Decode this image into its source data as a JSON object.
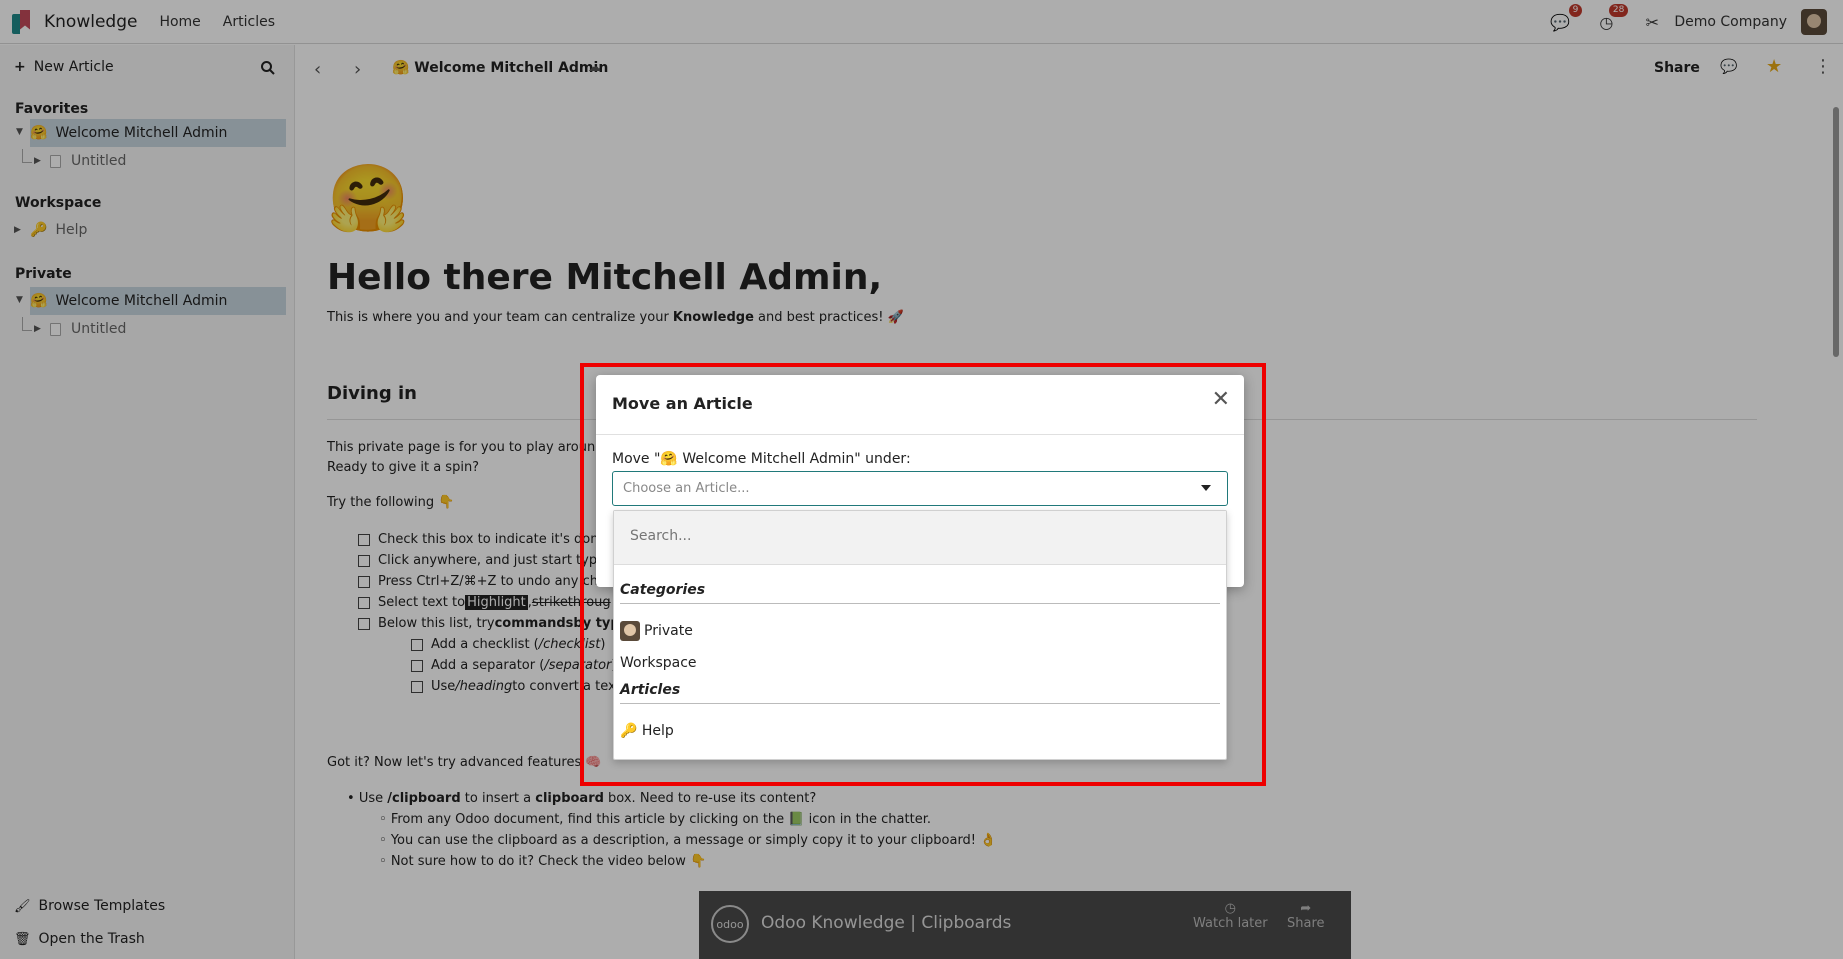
{
  "topbar": {
    "app_name": "Knowledge",
    "menu": [
      "Home",
      "Articles"
    ],
    "messages_count": "9",
    "activities_count": "28",
    "company": "Demo Company"
  },
  "sidebar": {
    "new_article": "New Article",
    "favorites_label": "Favorites",
    "workspace_label": "Workspace",
    "private_label": "Private",
    "favorites": [
      {
        "emoji": "🤗",
        "label": "Welcome Mitchell Admin"
      },
      {
        "label": "Untitled"
      }
    ],
    "workspace": [
      {
        "emoji": "🔑",
        "label": "Help"
      }
    ],
    "private": [
      {
        "emoji": "🤗",
        "label": "Welcome Mitchell Admin"
      },
      {
        "label": "Untitled"
      }
    ],
    "browse_templates": "Browse Templates",
    "open_trash": "Open the Trash"
  },
  "header": {
    "title": "🤗 Welcome Mitchell Admin",
    "share": "Share"
  },
  "article": {
    "emoji": "🤗",
    "heading": "Hello there Mitchell Admin,",
    "intro_pre": "This is where you and your team can centralize your ",
    "intro_bold": "Knowledge",
    "intro_post": " and best practices! 🚀",
    "section_heading": "Diving in",
    "p1": "This private page is for you to play around",
    "p2": "Ready to give it a spin?",
    "p3": "Try the following 👇",
    "checklist": [
      "Check this box to indicate it's done",
      "Click anywhere, and just start typi",
      "Press Ctrl+Z/⌘+Z to undo any chan",
      "Select text to ",
      "Below this list, try "
    ],
    "highlight_word": "Highlight",
    "strike_word": "strikethroug",
    "commands_bold": "commands",
    "by_typ": " by typi",
    "sub_checklist": [
      {
        "pre": "Add a checklist (",
        "italic": "/checklist",
        "post": ")"
      },
      {
        "pre": "Add a separator (",
        "italic": "/separator",
        "post": ")"
      },
      {
        "pre": "Use ",
        "italic": "/heading",
        "post": " to convert a tex"
      }
    ],
    "p4": "Got it? Now let's try advanced features 🧠",
    "bullet1_pre": "Use ",
    "bullet1_cmd": "/clipboard",
    "bullet1_mid": " to insert a ",
    "bullet1_bold": "clipboard",
    "bullet1_post": " box. Need to re-use its content?",
    "sub_bullets": [
      "From any Odoo document, find this article by clicking on the 📗 icon in the chatter.",
      "You can use the clipboard as a description, a message or simply copy it to your clipboard! 👌",
      "Not sure how to do it? Check the video below 👇"
    ],
    "video": {
      "logo": "odoo",
      "title": "Odoo Knowledge | Clipboards",
      "watch_later": "Watch later",
      "share": "Share"
    }
  },
  "modal": {
    "title": "Move an Article",
    "move_label": "Move \"🤗 Welcome Mitchell Admin\" under:",
    "select_placeholder": "Choose an Article..."
  },
  "dropdown": {
    "search_placeholder": "Search...",
    "groups": [
      {
        "label": "Categories",
        "options": [
          "Private",
          "Workspace"
        ]
      },
      {
        "label": "Articles",
        "options": [
          "🔑 Help"
        ]
      }
    ]
  }
}
